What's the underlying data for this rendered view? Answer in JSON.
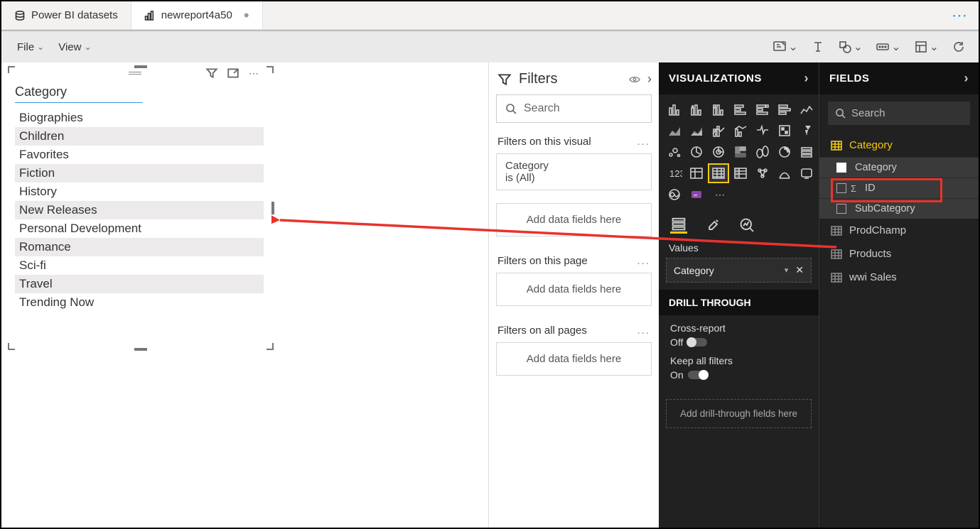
{
  "tabs": {
    "datasets_label": "Power BI datasets",
    "report_label": "newreport4a50"
  },
  "menu": {
    "file": "File",
    "view": "View"
  },
  "visual": {
    "title": "Category",
    "rows": [
      "Biographies",
      "Children",
      "Favorites",
      "Fiction",
      "History",
      "New Releases",
      "Personal Development",
      "Romance",
      "Sci-fi",
      "Travel",
      "Trending Now"
    ]
  },
  "filters": {
    "title": "Filters",
    "search_placeholder": "Search",
    "on_visual_label": "Filters on this visual",
    "visual_card_title": "Category",
    "visual_card_sub": "is (All)",
    "add_fields": "Add data fields here",
    "on_page_label": "Filters on this page",
    "all_pages_label": "Filters on all pages"
  },
  "viz": {
    "title": "VISUALIZATIONS",
    "values_label": "Values",
    "values_field": "Category",
    "drill_title": "DRILL THROUGH",
    "cross_report_label": "Cross-report",
    "cross_report_state": "Off",
    "keep_filters_label": "Keep all filters",
    "keep_filters_state": "On",
    "drill_placeholder": "Add drill-through fields here"
  },
  "fields": {
    "title": "FIELDS",
    "search_placeholder": "Search",
    "tables": [
      {
        "name": "Category",
        "active": true,
        "columns": [
          {
            "name": "Category",
            "checked": true
          },
          {
            "name": "ID",
            "sigma": true
          },
          {
            "name": "SubCategory"
          }
        ]
      },
      {
        "name": "ProdChamp"
      },
      {
        "name": "Products"
      },
      {
        "name": "wwi Sales"
      }
    ]
  }
}
